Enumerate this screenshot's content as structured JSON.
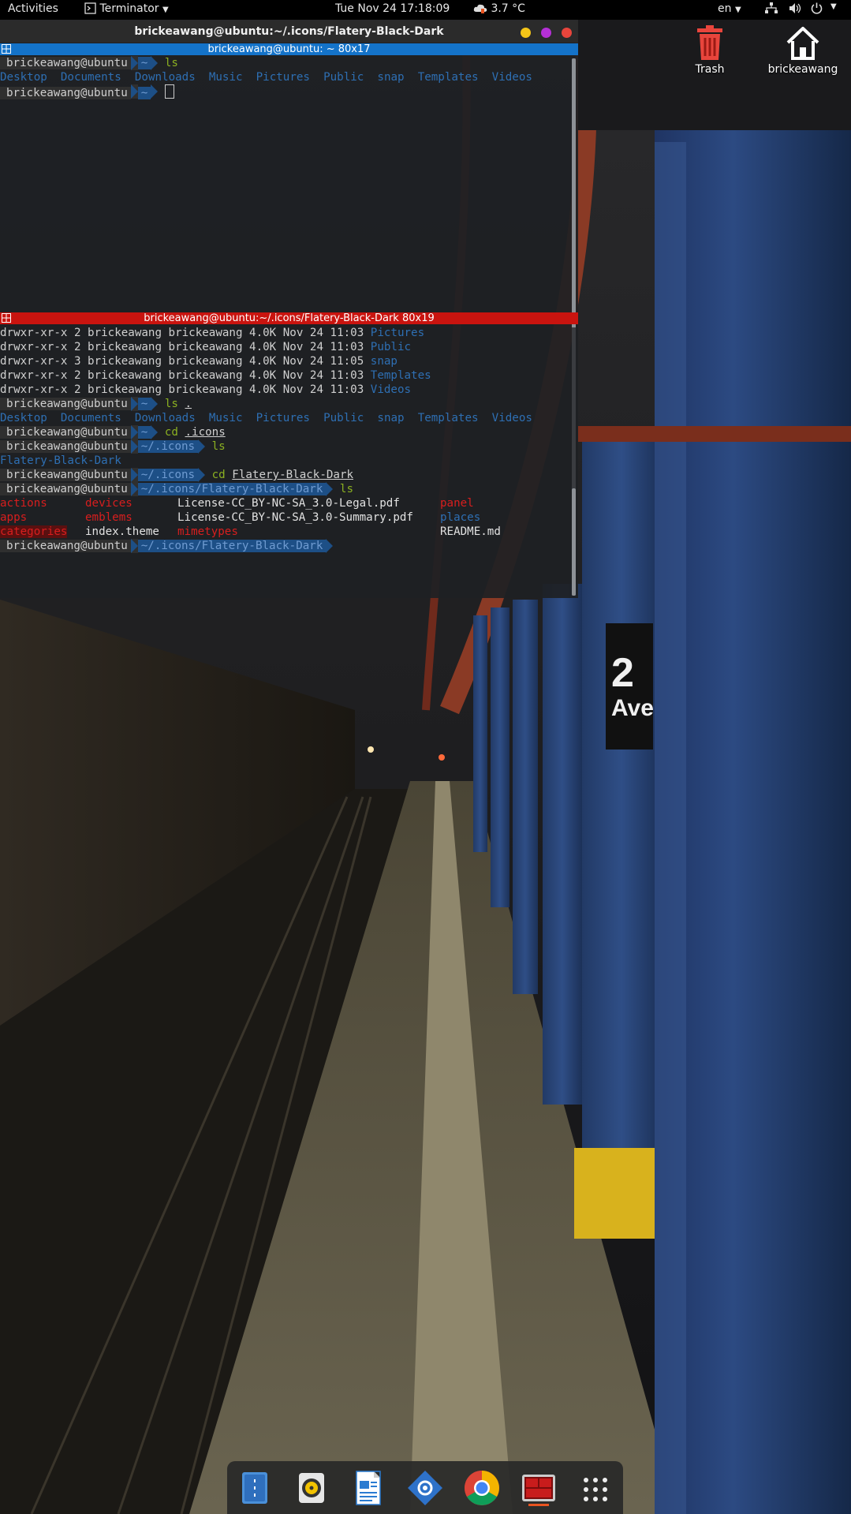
{
  "topbar": {
    "activities": "Activities",
    "app_name": "Terminator",
    "clock": "Tue Nov 24  17:18:09",
    "weather": "3.7 °C",
    "language": "en"
  },
  "desktop": {
    "trash_label": "Trash",
    "home_label": "brickeawang"
  },
  "window": {
    "title": "brickeawang@ubuntu:~/.icons/Flatery-Black-Dark",
    "buttons": {
      "minimize_color": "#f5c518",
      "maximize_color": "#b530d6",
      "close_color": "#e8453c"
    }
  },
  "pane1": {
    "title": "brickeawang@ubuntu: ~ 80x17",
    "title_bg": "#1473c9",
    "user": "brickeawang@ubuntu",
    "dir": "~",
    "cmd_ls": "ls",
    "listing": [
      "Desktop",
      "Documents",
      "Downloads",
      "Music",
      "Pictures",
      "Public",
      "snap",
      "Templates",
      "Videos"
    ]
  },
  "pane2": {
    "title": "brickeawang@ubuntu:~/.icons/Flatery-Black-Dark 80x19",
    "title_bg": "#c9140f",
    "long_listing": [
      {
        "perm": "drwxr-xr-x 2 brickeawang brickeawang 4.0K Nov 24 11:03 ",
        "name": "Pictures"
      },
      {
        "perm": "drwxr-xr-x 2 brickeawang brickeawang 4.0K Nov 24 11:03 ",
        "name": "Public"
      },
      {
        "perm": "drwxr-xr-x 3 brickeawang brickeawang 4.0K Nov 24 11:05 ",
        "name": "snap"
      },
      {
        "perm": "drwxr-xr-x 2 brickeawang brickeawang 4.0K Nov 24 11:03 ",
        "name": "Templates"
      },
      {
        "perm": "drwxr-xr-x 2 brickeawang brickeawang 4.0K Nov 24 11:03 ",
        "name": "Videos"
      }
    ],
    "cmd_ls_dot": "ls",
    "cmd_ls_dot_arg": ".",
    "listing": [
      "Desktop",
      "Documents",
      "Downloads",
      "Music",
      "Pictures",
      "Public",
      "snap",
      "Templates",
      "Videos"
    ],
    "cmd_cd": "cd",
    "cd_arg1": ".icons",
    "dir_home": "~",
    "dir_icons": "~/.icons",
    "dir_theme": "~/.icons/Flatery-Black-Dark",
    "icons_listing": "Flatery-Black-Dark",
    "cd_arg2": "Flatery-Black-Dark",
    "cmd_ls": "ls",
    "theme_files": {
      "col1": [
        "actions",
        "apps",
        "categories"
      ],
      "col2": [
        "devices",
        "emblems",
        "index.theme"
      ],
      "col3": [
        "License-CC_BY-NC-SA_3.0-Legal.pdf",
        "License-CC_BY-NC-SA_3.0-Summary.pdf",
        "mimetypes"
      ],
      "col4": [
        "panel",
        "places",
        "README.md"
      ]
    }
  },
  "dock": {
    "items": [
      "files",
      "rhythmbox",
      "writer",
      "software-center",
      "chrome",
      "terminator",
      "show-apps"
    ]
  }
}
